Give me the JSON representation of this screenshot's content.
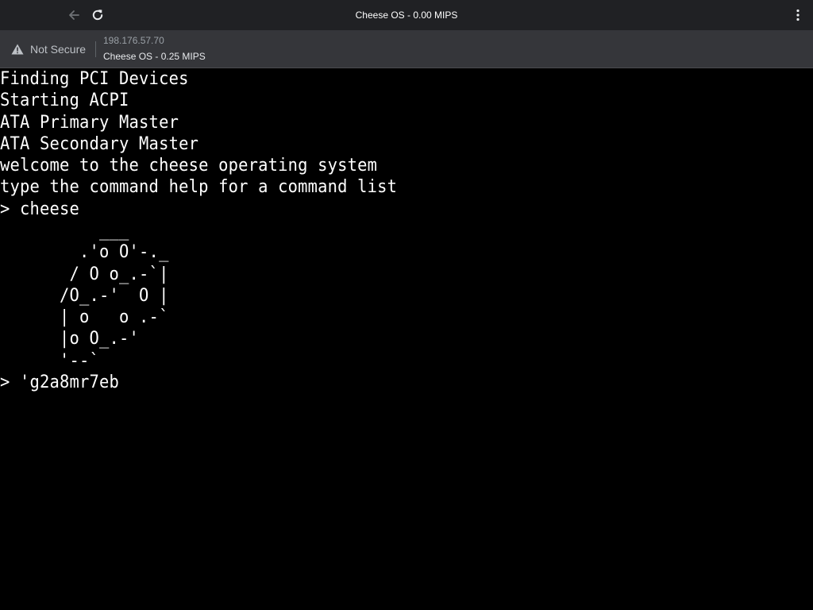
{
  "browser": {
    "tab_title": "Cheese OS - 0.00 MIPS",
    "security_label": "Not Secure",
    "url": "198.176.57.70",
    "page_subtitle": "Cheese OS - 0.25 MIPS",
    "icons": {
      "back": "arrow-left-icon",
      "reload": "reload-icon",
      "menu": "more-vert-icon",
      "security": "warning-triangle-icon"
    }
  },
  "terminal": {
    "boot_log": "Finding PCI Devices\nStarting ACPI\nATA Primary Master\nATA Secondary Master\nwelcome to the cheese operating system\ntype the command help for a command list\n> cheese",
    "ascii_art": "          ___\n        .'o O'-._\n       / O o_.-`|\n      /O_.-'  O |\n      | o   o .-`\n      |o O_.-'\n      '--`",
    "prompt": "> 'g2a8mr7eb",
    "colors": {
      "background": "#000000",
      "foreground": "#ffffff"
    }
  }
}
